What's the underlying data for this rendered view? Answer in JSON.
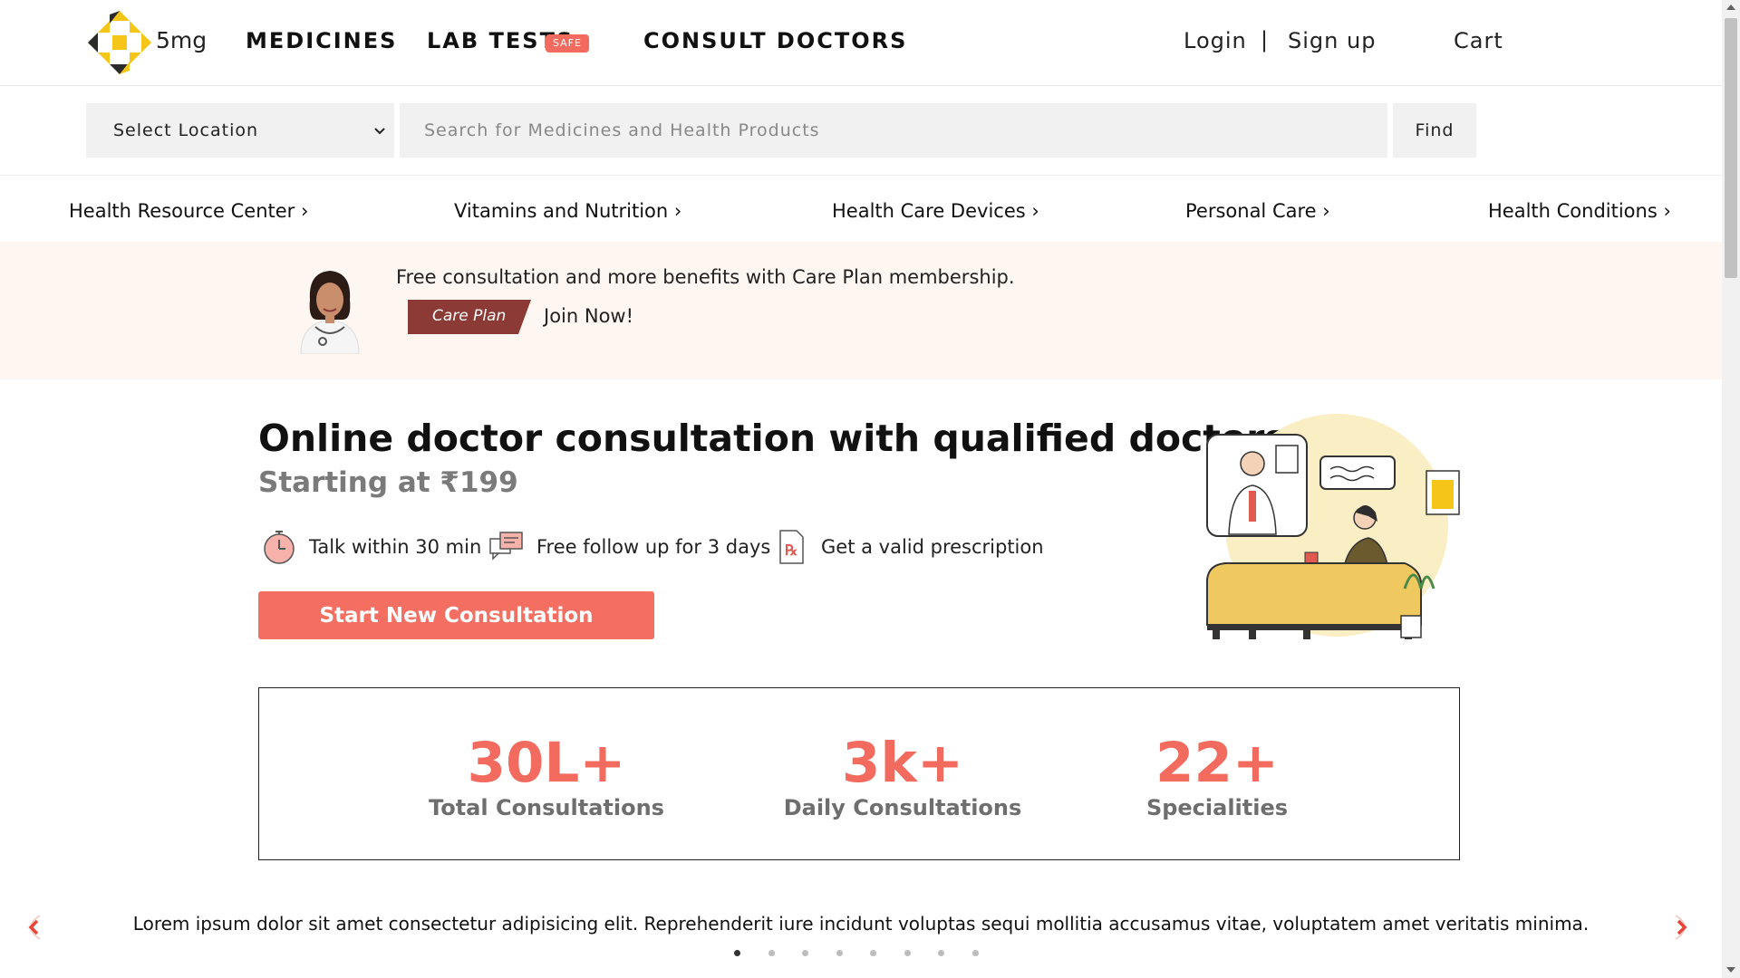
{
  "header": {
    "brand": "5mg",
    "nav": [
      {
        "label": "MEDICINES"
      },
      {
        "label": "LAB TESTS",
        "badge": "SAFE"
      },
      {
        "label": "CONSULT DOCTORS"
      }
    ],
    "login": "Login",
    "separator": "|",
    "signup": "Sign up",
    "cart": "Cart"
  },
  "search": {
    "location_label": "Select Location",
    "placeholder": "Search for Medicines and Health Products",
    "find_label": "Find"
  },
  "categories": [
    "Health Resource Center ›",
    "Vitamins and Nutrition ›",
    "Health Care Devices ›",
    "Personal Care ›",
    "Health Conditions ›"
  ],
  "banner": {
    "text": "Free consultation and more benefits with Care Plan membership.",
    "tag": "Care Plan",
    "join": "Join Now!"
  },
  "hero": {
    "title": "Online doctor consultation with qualified doctors",
    "subtitle": "Starting at ₹199",
    "features": [
      {
        "icon": "alarm-clock-icon",
        "text": "Talk within 30 min"
      },
      {
        "icon": "chat-followup-icon",
        "text": "Free follow up for 3 days"
      },
      {
        "icon": "prescription-icon",
        "text": "Get a valid prescription"
      }
    ],
    "cta": "Start New Consultation"
  },
  "stats": [
    {
      "value": "30L+",
      "label": "Total Consultations"
    },
    {
      "value": "3k+",
      "label": "Daily Consultations"
    },
    {
      "value": "22+",
      "label": "Specialities"
    }
  ],
  "testimonial": {
    "text": "Lorem ipsum dolor sit amet consectetur adipisicing elit. Reprehenderit iure incidunt voluptas sequi mollitia accusamus vitae, voluptatem amet veritatis minima.",
    "dot_count": 8,
    "active_dot": 1
  },
  "colors": {
    "accent": "#f26b5e",
    "cta": "#f56e62",
    "banner_bg": "#fdf6f1",
    "care_plan_tag": "#8b3a35",
    "logo_yellow": "#f5c518",
    "logo_dark": "#2b2b2b"
  }
}
